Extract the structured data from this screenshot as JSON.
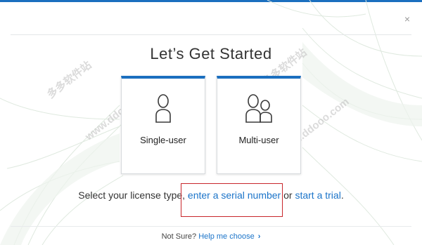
{
  "window": {
    "close_symbol": "×",
    "close_icon": "close-icon"
  },
  "title": "Let’s Get Started",
  "options": [
    {
      "label": "Single-user",
      "icon": "single-user-icon"
    },
    {
      "label": "Multi-user",
      "icon": "multi-user-icon"
    }
  ],
  "license_prompt": {
    "prefix": "Select your license type,",
    "serial_link": "enter a serial number",
    "middle": "or",
    "trial_link": "start a trial",
    "suffix": "."
  },
  "footer": {
    "prompt": "Not Sure?",
    "help_link": "Help me choose",
    "chevron": "›"
  },
  "watermarks": [
    "多多软件站",
    "www.ddooo.com",
    "多多软件站",
    "www.ddooo.com"
  ],
  "colors": {
    "accent": "#1b6fbf",
    "link": "#1b74c9",
    "highlight": "#c8262b"
  }
}
